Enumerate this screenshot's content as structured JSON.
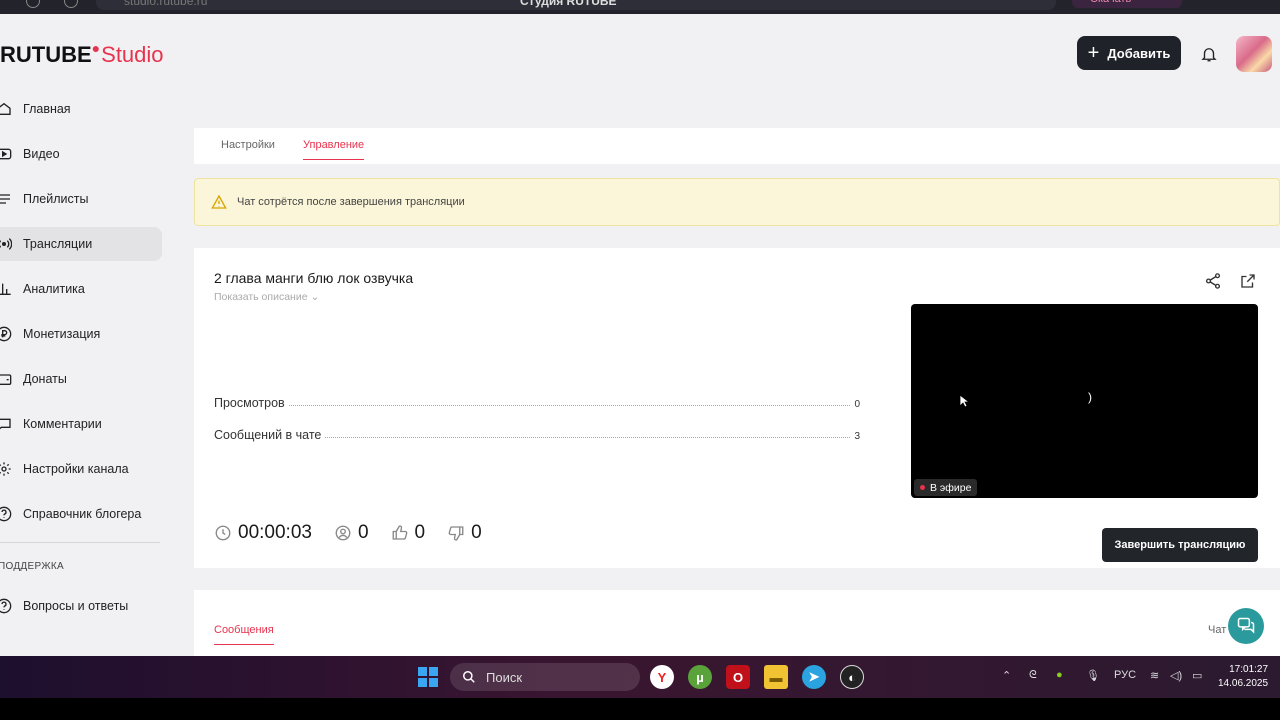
{
  "browser": {
    "url": "studio.rutube.ru",
    "window_title": "Студия RUTUBE",
    "pill_label": "Скачать"
  },
  "header": {
    "logo_main": "RUTUBE",
    "logo_studio": "Studio",
    "add_button": "Добавить"
  },
  "sidebar": {
    "items": [
      {
        "label": "Главная",
        "icon": "home-icon"
      },
      {
        "label": "Видео",
        "icon": "video-icon"
      },
      {
        "label": "Плейлисты",
        "icon": "playlist-icon"
      },
      {
        "label": "Трансляции",
        "icon": "broadcast-icon",
        "active": true
      },
      {
        "label": "Аналитика",
        "icon": "analytics-icon"
      },
      {
        "label": "Монетизация",
        "icon": "ruble-icon"
      },
      {
        "label": "Донаты",
        "icon": "wallet-icon"
      },
      {
        "label": "Комментарии",
        "icon": "comment-icon"
      },
      {
        "label": "Настройки канала",
        "icon": "gear-icon"
      },
      {
        "label": "Справочник блогера",
        "icon": "help-circle-icon"
      }
    ],
    "support_heading": "ПОДДЕРЖКА",
    "support_items": [
      {
        "label": "Вопросы и ответы",
        "icon": "question-icon"
      }
    ]
  },
  "tabs": {
    "settings": "Настройки",
    "management": "Управление"
  },
  "warning": {
    "text": "Чат сотрётся после завершения трансляции"
  },
  "stream": {
    "title": "2 глава манги блю лок озвучка",
    "show_description": "Показать описание",
    "stats": [
      {
        "label": "Просмотров",
        "value": "0"
      },
      {
        "label": "Сообщений в чате",
        "value": "3"
      }
    ],
    "duration": "00:00:03",
    "viewers": "0",
    "likes": "0",
    "dislikes": "0",
    "live_label": "В эфире",
    "end_button": "Завершить трансляцию"
  },
  "messages": {
    "tab": "Сообщения",
    "chat_tab": "Чат"
  },
  "taskbar": {
    "search": "Поиск",
    "lang": "РУС",
    "time": "17:01:27",
    "date": "14.06.2025"
  },
  "colors": {
    "accent": "#e7334e",
    "dark_button": "#1f2228",
    "warning_bg": "#fbf6d9",
    "help_fab": "#2a9a9c"
  }
}
